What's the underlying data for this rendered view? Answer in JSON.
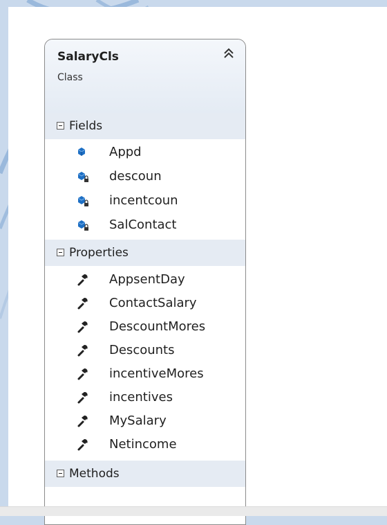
{
  "class": {
    "name": "SalaryCls",
    "stereotype": "Class"
  },
  "sections": [
    {
      "label": "Fields",
      "members": [
        {
          "name": "Appd",
          "icon": "field-icon"
        },
        {
          "name": "descoun",
          "icon": "private-field-icon"
        },
        {
          "name": "incentcoun",
          "icon": "private-field-icon"
        },
        {
          "name": "SalContact",
          "icon": "private-field-icon"
        }
      ]
    },
    {
      "label": "Properties",
      "members": [
        {
          "name": "AppsentDay",
          "icon": "property-wrench-icon"
        },
        {
          "name": "ContactSalary",
          "icon": "property-wrench-icon"
        },
        {
          "name": "DescountMores",
          "icon": "property-wrench-icon"
        },
        {
          "name": "Descounts",
          "icon": "property-wrench-icon"
        },
        {
          "name": "incentiveMores",
          "icon": "property-wrench-icon"
        },
        {
          "name": "incentives",
          "icon": "property-wrench-icon"
        },
        {
          "name": "MySalary",
          "icon": "property-wrench-icon"
        },
        {
          "name": "Netincome",
          "icon": "property-wrench-icon"
        }
      ]
    },
    {
      "label": "Methods",
      "members": []
    }
  ],
  "colors": {
    "page_background": "#c9d9ec",
    "header_background": "#e4ebf4",
    "section_background": "#e5ebf3",
    "field_icon": "#1d6fc4",
    "wrench_icon": "#222222"
  }
}
